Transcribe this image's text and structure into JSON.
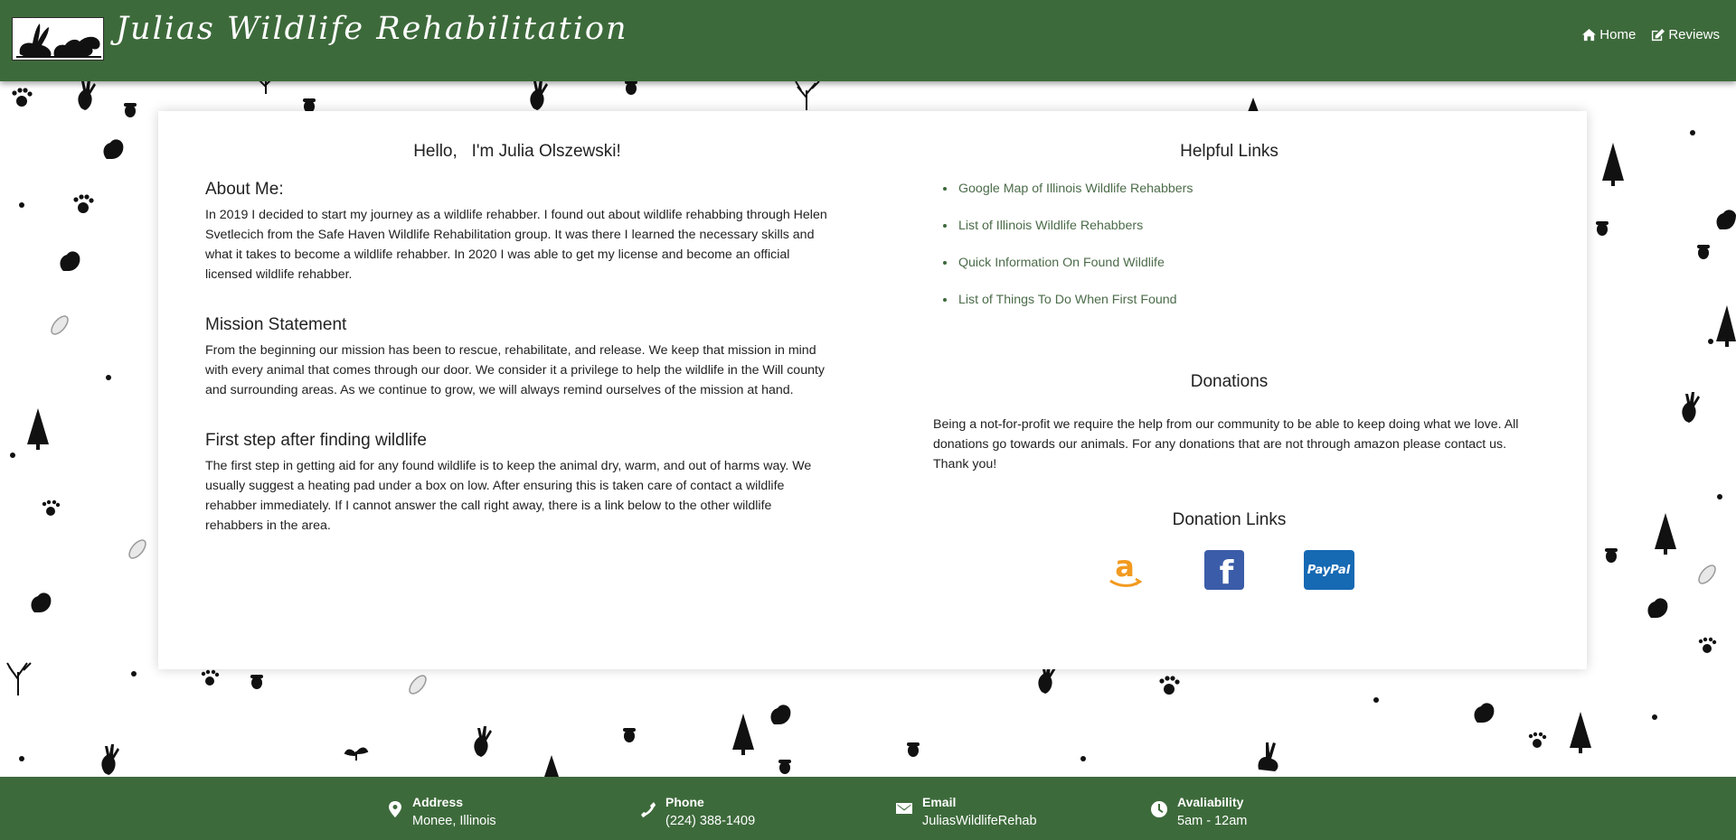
{
  "header": {
    "site_title": "Julias Wildlife Rehabilitation",
    "nav": [
      {
        "label": "Home",
        "icon": "home-icon"
      },
      {
        "label": "Reviews",
        "icon": "edit-icon"
      }
    ]
  },
  "main": {
    "greeting": "Hello,   I'm Julia Olszewski!",
    "sections": [
      {
        "title": "About Me:",
        "body": "In 2019 I decided to start my journey as a wildlife rehabber. I found out about wildlife rehabbing through Helen Svetlecich from the Safe Haven Wildlife Rehabilitation group. It was there I learned the necessary skills and what it takes to become a wildlife rehabber. In 2020 I was able to get my license and become an official licensed wildlife rehabber."
      },
      {
        "title": "Mission Statement",
        "body": "From the beginning our mission has been to rescue, rehabilitate, and release. We keep that mission in mind with every animal that comes through our door. We consider it a privilege to help the wildlife in the Will county and surrounding areas. As we continue to grow, we will always remind ourselves of the mission at hand."
      },
      {
        "title": "First step after finding wildlife",
        "body": "The first step in getting aid for any found wildlife is to keep the animal dry, warm, and out of harms way. We usually suggest a heating pad under a box on low. After ensuring this is taken care of contact a wildlife rehabber immediately. If I cannot answer the call right away, there is a link below to the other wildlife rehabbers in the area."
      }
    ],
    "helpful_links_title": "Helpful Links",
    "helpful_links": [
      "Google Map of Illinois Wildlife Rehabbers",
      "List of Illinois Wildlife Rehabbers",
      "Quick Information On Found Wildlife",
      "List of Things To Do When First Found"
    ],
    "donations_title": "Donations",
    "donations_body": "Being a not-for-profit we require the help from our community to be able to keep doing what we love. All donations go towards our animals. For any donations that are not through amazon please contact us. Thank you!",
    "donation_links_title": "Donation Links",
    "donation_links": [
      {
        "name": "amazon",
        "icon": "amazon-icon"
      },
      {
        "name": "facebook",
        "icon": "facebook-icon",
        "glyph": "f"
      },
      {
        "name": "paypal",
        "icon": "paypal-icon",
        "glyph": "PayPal"
      }
    ]
  },
  "footer": {
    "items": [
      {
        "label": "Address",
        "value": "Monee, Illinois",
        "icon": "location-pin-icon"
      },
      {
        "label": "Phone",
        "value": "(224) 388-1409",
        "icon": "phone-icon"
      },
      {
        "label": "Email",
        "value": "JuliasWildlifeRehab",
        "icon": "email-icon"
      },
      {
        "label": "Avaliability",
        "value": "5am - 12am",
        "icon": "clock-icon"
      }
    ]
  },
  "colors": {
    "brand_green": "#3d6a3b",
    "link_green": "#4c6c4a",
    "amazon_orange": "#f29a1f",
    "facebook_blue": "#3b5ca8",
    "paypal_blue": "#1669b3"
  }
}
